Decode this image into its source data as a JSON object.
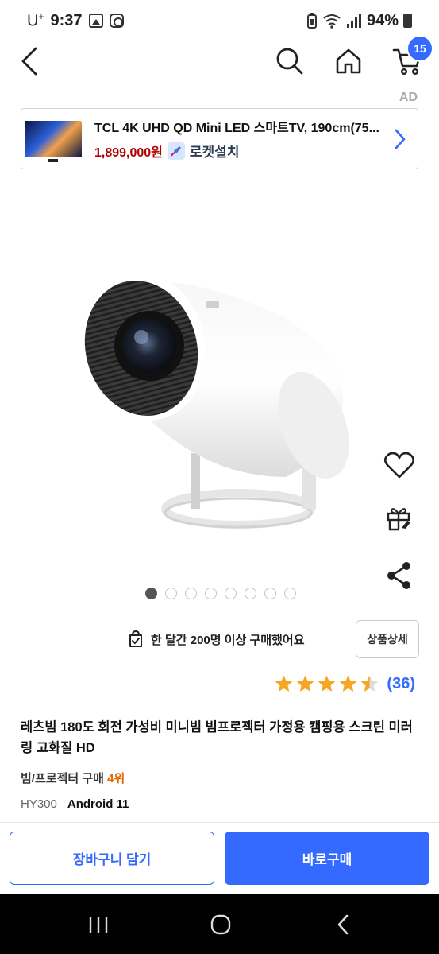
{
  "status_bar": {
    "carrier": "U",
    "carrier_sup": "+",
    "time": "9:37",
    "battery": "94%"
  },
  "top_nav": {
    "cart_count": "15"
  },
  "ad": {
    "label": "AD",
    "title": "TCL 4K UHD QD Mini LED 스마트TV, 190cm(75...",
    "price": "1,899,000원",
    "badge": "로켓설치"
  },
  "gallery": {
    "total_images": 8,
    "current_index": 1
  },
  "purchase_info": "한 달간 200명 이상 구매했어요",
  "detail_button": "상품상세",
  "rating": {
    "stars": 4.5,
    "review_count": "(36)"
  },
  "product": {
    "title": "레츠빔 180도 회전 가성비 미니빔 빔프로젝터 가정용 캠핑용 스크린 미러링 고화질 HD",
    "category": "빔/프로젝터 구매",
    "rank": "4위",
    "model": "HY300",
    "os": "Android 11"
  },
  "bottom_bar": {
    "add_to_cart": "장바구니 담기",
    "buy_now": "바로구매"
  },
  "colors": {
    "accent": "#346aff",
    "star": "#f5a623",
    "price": "#ae0000",
    "rank": "#e16b00"
  }
}
